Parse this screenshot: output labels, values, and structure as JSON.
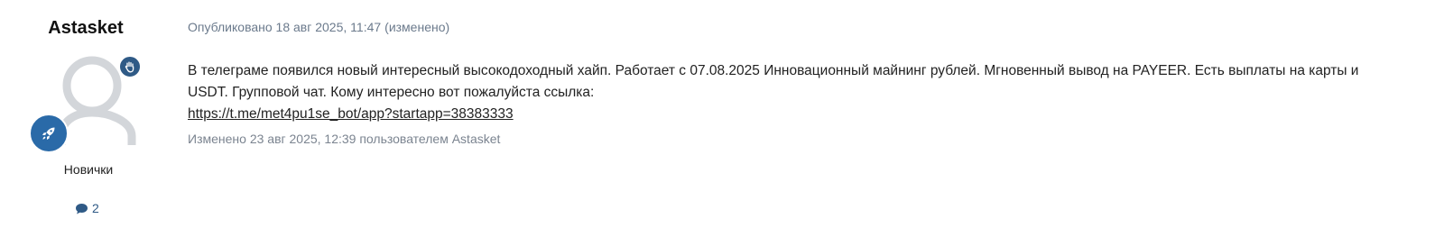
{
  "author": {
    "name": "Astasket",
    "rank": "Новички",
    "post_count": "2",
    "badges": [
      "hand-icon",
      "rocket-icon"
    ],
    "avatar": "default-user-avatar"
  },
  "post": {
    "meta": {
      "published": "Опубликовано 18 авг 2025, 11:47",
      "edited_flag": "(изменено)"
    },
    "body_line1": "В телеграме появился новый интересный высокодоходный хайп. Работает с 07.08.2025 Инновационный майнинг рублей. Мгновенный вывод на PAYEER. Есть выплаты на карты и USDT. Групповой чат. Кому интересно вот пожалуйста ссылка:",
    "link": "https://t.me/met4pu1se_bot/app?startapp=38383333",
    "edit_note": "Изменено 23 авг 2025, 12:39 пользователем Astasket"
  },
  "colors": {
    "accent": "#2f5a86",
    "rocket_badge": "#2a6aa8",
    "meta_text": "#6b7a8c",
    "avatar_gray": "#d3d6da"
  }
}
